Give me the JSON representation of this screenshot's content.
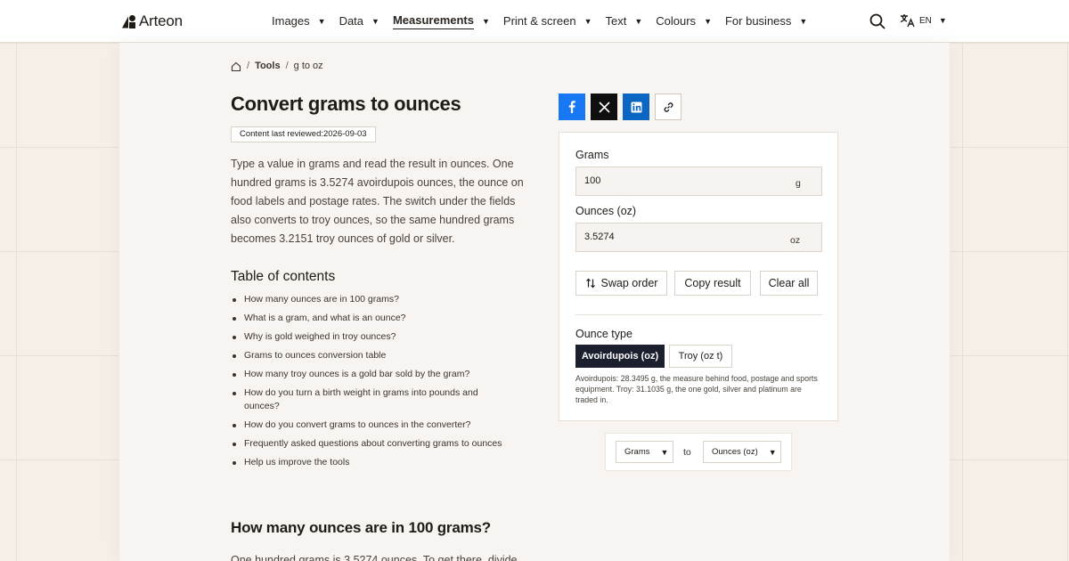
{
  "brand": {
    "name": "Arteon"
  },
  "nav": {
    "items": [
      {
        "label": "Images"
      },
      {
        "label": "Data"
      },
      {
        "label": "Measurements",
        "active": true
      },
      {
        "label": "Print & screen"
      },
      {
        "label": "Text"
      },
      {
        "label": "Colours"
      },
      {
        "label": "For business"
      }
    ],
    "language": "EN"
  },
  "breadcrumb": {
    "tools": "Tools",
    "current": "g to oz"
  },
  "page": {
    "title": "Convert grams to ounces",
    "reviewed": "Content last reviewed:2026-09-03",
    "intro": "Type a value in grams and read the result in ounces. One hundred grams is 3.5274 avoirdupois ounces, the ounce on food labels and postage rates. The switch under the fields also converts to troy ounces, so the same hundred grams becomes 3.2151 troy ounces of gold or silver."
  },
  "toc": {
    "title": "Table of contents",
    "items": [
      "How many ounces are in 100 grams?",
      "What is a gram, and what is an ounce?",
      "Why is gold weighed in troy ounces?",
      "Grams to ounces conversion table",
      "How many troy ounces is a gold bar sold by the gram?",
      "How do you turn a birth weight in grams into pounds and ounces?",
      "How do you convert grams to ounces in the converter?",
      "Frequently asked questions about converting grams to ounces",
      "Help us improve the tools"
    ]
  },
  "section": {
    "heading": "How many ounces are in 100 grams?",
    "text_start": "One hundred grams is 3.5274 ounces. To get there, divide"
  },
  "converter": {
    "grams_label": "Grams",
    "grams_value": "100",
    "grams_unit": "g",
    "ounces_label": "Ounces (oz)",
    "ounces_value": "3.5274",
    "ounces_unit": "oz",
    "swap_label": "Swap order",
    "copy_label": "Copy result",
    "clear_label": "Clear all",
    "ounce_type_label": "Ounce type",
    "ounce_types": [
      "Avoirdupois (oz)",
      "Troy (oz t)"
    ],
    "selected_type": "Avoirdupois (oz)",
    "note": "Avoirdupois: 28.3495 g, the measure behind food, postage and sports equipment. Troy: 31.1035 g, the one gold, silver and platinum are traded in."
  },
  "unit_pair": {
    "from": "Grams",
    "to_word": "to",
    "to": "Ounces (oz)"
  },
  "colors": {
    "facebook": "#1877f2",
    "x": "#0f0f0f",
    "linkedin": "#0a66c2",
    "active_segment": "#1c1f2e"
  }
}
